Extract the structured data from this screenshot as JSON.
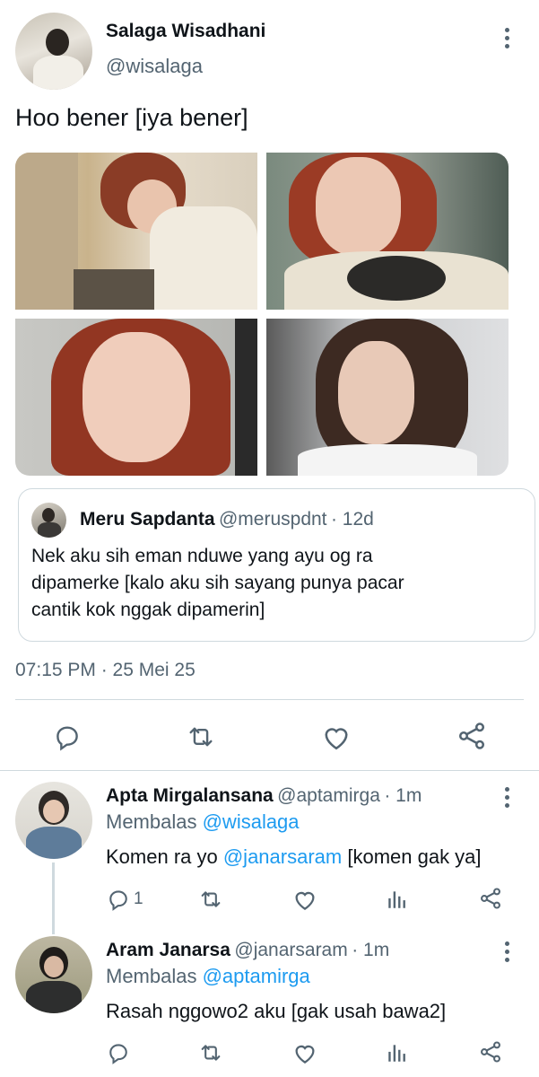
{
  "main_tweet": {
    "author_name": "Salaga Wisadhani",
    "author_handle": "@wisalaga",
    "text": "Hoo bener [iya bener]",
    "timestamp": "07:15 PM · 25 Mei 25",
    "quoted": {
      "author_name": "Meru Sapdanta",
      "author_handle": "@meruspdnt",
      "time": "· 12d",
      "text_lines": [
        "Nek aku sih eman nduwe yang ayu og ra",
        "dipamerke [kalo aku sih sayang punya pacar",
        "cantik kok nggak dipamerin]"
      ]
    }
  },
  "replies": [
    {
      "author_name": "Apta Mirgalansana",
      "author_handle": "@aptamirga",
      "time": "· 1m",
      "replying_prefix": "Membalas ",
      "replying_to": "@wisalaga",
      "text_pre": "Komen ra yo ",
      "mention": "@janarsaram",
      "text_post": " [komen gak ya]",
      "reply_count": "1"
    },
    {
      "author_name": "Aram Janarsa",
      "author_handle": "@janarsaram",
      "time": "· 1m",
      "replying_prefix": "Membalas ",
      "replying_to": "@aptamirga",
      "text": "Rasah nggowo2 aku [gak usah bawa2]"
    }
  ],
  "colors": {
    "accent": "#1d9bf0",
    "secondary": "#536471",
    "border": "#cfd9de"
  }
}
